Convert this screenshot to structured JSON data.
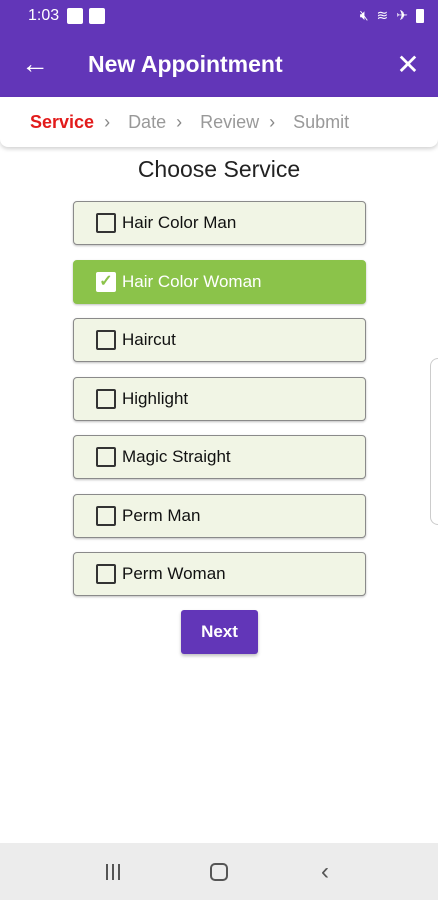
{
  "status_bar": {
    "time": "1:03",
    "icons": [
      "image-icon",
      "notification-icon",
      "mute-icon",
      "wifi-icon",
      "airplane-icon",
      "battery-icon"
    ]
  },
  "app_bar": {
    "title": "New Appointment",
    "back_icon": "arrow-left-icon",
    "close_icon": "close-icon"
  },
  "steps": [
    {
      "label": "Service",
      "active": true
    },
    {
      "label": "Date",
      "active": false
    },
    {
      "label": "Review",
      "active": false
    },
    {
      "label": "Submit",
      "active": false
    }
  ],
  "heading": "Choose Service",
  "services": [
    {
      "label": "Hair Color Man",
      "checked": false
    },
    {
      "label": "Hair Color Woman",
      "checked": true
    },
    {
      "label": "Haircut",
      "checked": false
    },
    {
      "label": "Highlight",
      "checked": false
    },
    {
      "label": "Magic Straight",
      "checked": false
    },
    {
      "label": "Perm Man",
      "checked": false
    },
    {
      "label": "Perm Woman",
      "checked": false
    }
  ],
  "next_label": "Next",
  "colors": {
    "primary": "#6236b8",
    "active_step": "#e21b1b",
    "selected": "#8bc34a",
    "item_bg": "#f1f5e5"
  }
}
